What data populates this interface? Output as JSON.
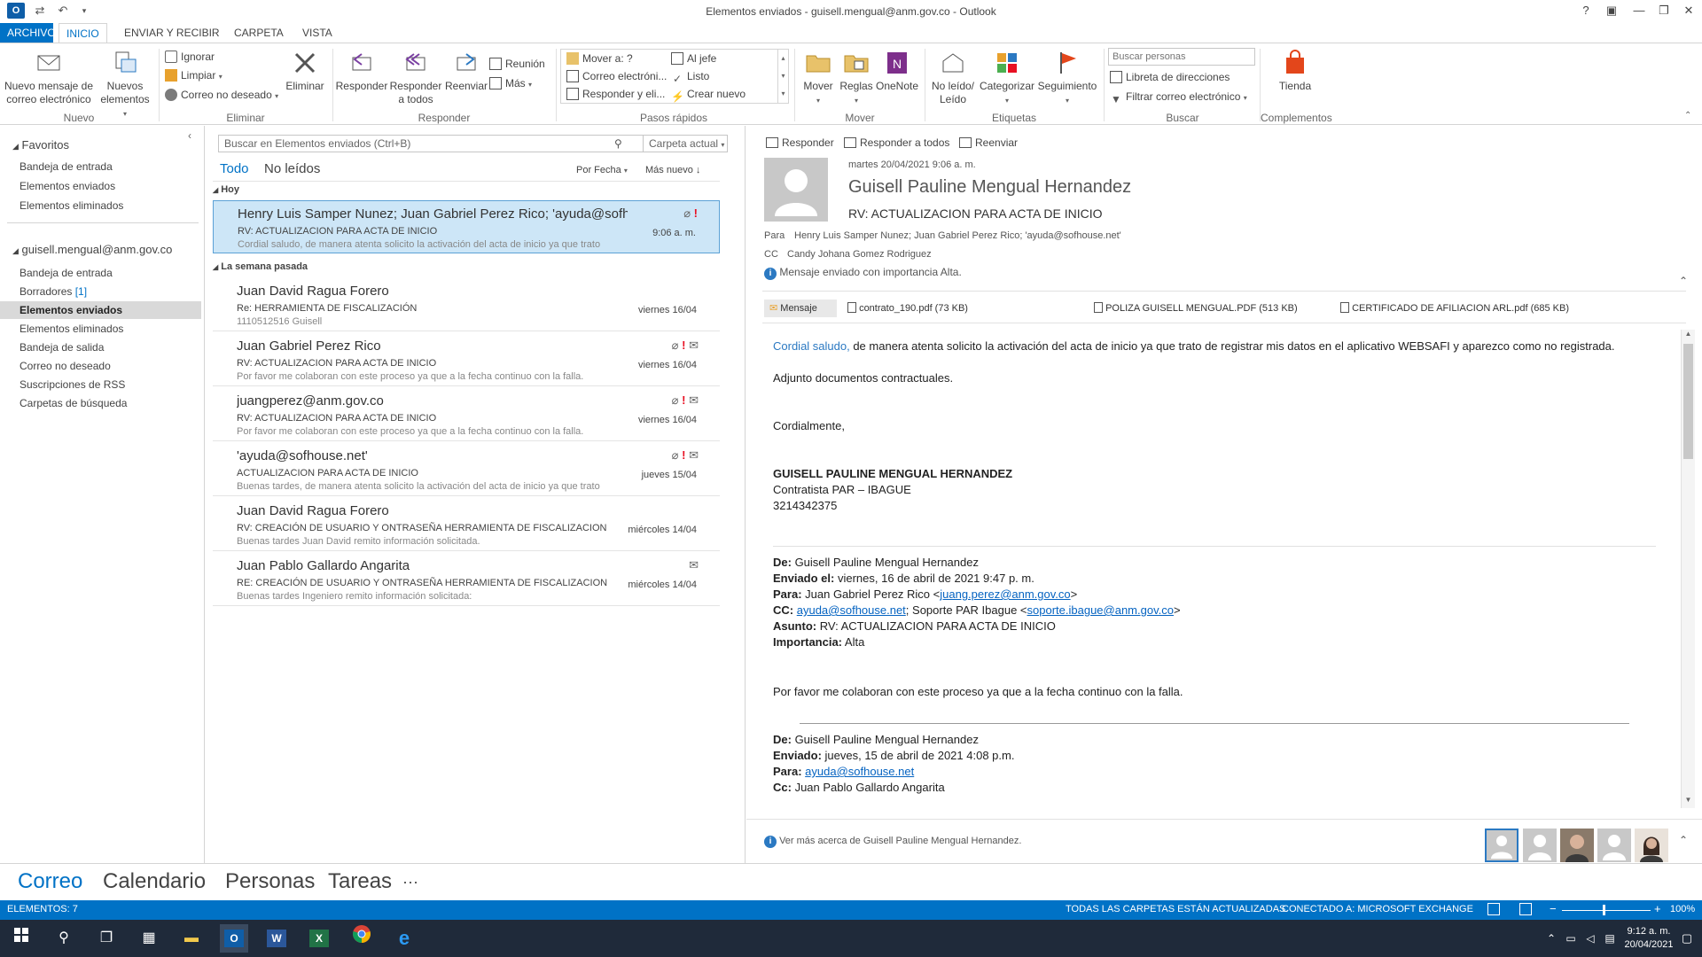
{
  "window": {
    "title": "Elementos enviados - guisell.mengual@anm.gov.co - Outlook"
  },
  "tabs": [
    "ARCHIVO",
    "INICIO",
    "ENVIAR Y RECIBIR",
    "CARPETA",
    "VISTA"
  ],
  "ribbon": {
    "new_email": "Nuevo mensaje de correo electrónico",
    "new_items": "Nuevos elementos",
    "group_new": "Nuevo",
    "ignore": "Ignorar",
    "clean": "Limpiar",
    "junk": "Correo no deseado",
    "delete": "Eliminar",
    "group_delete": "Eliminar",
    "reply": "Responder",
    "reply_all": "Responder a todos",
    "forward": "Reenviar",
    "meeting": "Reunión",
    "more": "Más",
    "group_respond": "Responder",
    "qs_move": "Mover a: ?",
    "qs_email": "Correo electróni...",
    "qs_reply_delete": "Responder y eli...",
    "qs_boss": "Al jefe",
    "qs_done": "Listo",
    "qs_new": "Crear nuevo",
    "group_quicksteps": "Pasos rápidos",
    "move": "Mover",
    "rules": "Reglas",
    "onenote": "OneNote",
    "group_move": "Mover",
    "unread_read": "No leído/ Leído",
    "categorize": "Categorizar",
    "followup": "Seguimiento",
    "group_tags": "Etiquetas",
    "search_people_placeholder": "Buscar personas",
    "address_book": "Libreta de direcciones",
    "filter_email": "Filtrar correo electrónico",
    "group_find": "Buscar",
    "store": "Tienda",
    "group_addins": "Complementos"
  },
  "nav": {
    "favorites": "Favoritos",
    "fav_items": [
      "Bandeja de entrada",
      "Elementos enviados",
      "Elementos eliminados"
    ],
    "account": "guisell.mengual@anm.gov.co",
    "inbox": "Bandeja de entrada",
    "drafts": "Borradores",
    "drafts_count": "[1]",
    "sent": "Elementos enviados",
    "deleted": "Elementos eliminados",
    "outbox": "Bandeja de salida",
    "junk": "Correo no deseado",
    "rss": "Suscripciones de RSS",
    "search_folders": "Carpetas de búsqueda"
  },
  "list": {
    "search_placeholder": "Buscar en Elementos enviados (Ctrl+B)",
    "scope": "Carpeta actual",
    "filter_all": "Todo",
    "filter_unread": "No leídos",
    "sort_by": "Por Fecha",
    "sort_order": "Más nuevo",
    "group_today": "Hoy",
    "group_lastweek": "La semana pasada",
    "messages": [
      {
        "from": "Henry Luis Samper Nunez; Juan Gabriel Perez Rico; 'ayuda@sofh...",
        "subject": "RV: ACTUALIZACION PARA ACTA DE INICIO",
        "preview": "Cordial saludo, de manera atenta solicito la activación del acta de inicio ya que trato",
        "date": "9:06 a. m."
      },
      {
        "from": "Juan David Ragua Forero",
        "subject": "Re: HERRAMIENTA DE FISCALIZACIÓN",
        "preview": "1110512516 Guisell",
        "date": "viernes 16/04"
      },
      {
        "from": "Juan Gabriel Perez Rico",
        "subject": "RV: ACTUALIZACION PARA ACTA DE INICIO",
        "preview": "Por favor me colaboran con este proceso ya que a la fecha continuo con la falla.",
        "date": "viernes 16/04"
      },
      {
        "from": "juangperez@anm.gov.co",
        "subject": "RV: ACTUALIZACION PARA ACTA DE INICIO",
        "preview": "Por favor me colaboran con este proceso ya que a la fecha continuo con la falla.",
        "date": "viernes 16/04"
      },
      {
        "from": "'ayuda@sofhouse.net'",
        "subject": "ACTUALIZACION PARA ACTA DE INICIO",
        "preview": "Buenas tardes, de manera atenta solicito la activación del acta de inicio ya que trato",
        "date": "jueves 15/04"
      },
      {
        "from": "Juan David Ragua Forero",
        "subject": "RV: CREACIÓN DE USUARIO Y ONTRASEÑA HERRAMIENTA DE FISCALIZACION",
        "preview": "Buenas tardes Juan David remito información solicitada.",
        "date": "miércoles 14/04"
      },
      {
        "from": "Juan Pablo Gallardo Angarita",
        "subject": "RE: CREACIÓN DE USUARIO Y ONTRASEÑA HERRAMIENTA DE FISCALIZACION",
        "preview": "Buenas tardes Ingeniero remito información solicitada:",
        "date": "miércoles 14/04"
      }
    ]
  },
  "reading": {
    "reply": "Responder",
    "reply_all": "Responder a todos",
    "forward": "Reenviar",
    "datetime": "martes 20/04/2021 9:06 a. m.",
    "sender": "Guisell Pauline Mengual Hernandez",
    "subject": "RV: ACTUALIZACION PARA ACTA DE INICIO",
    "to_label": "Para",
    "to": "Henry Luis Samper Nunez; Juan Gabriel Perez Rico; 'ayuda@sofhouse.net'",
    "cc_label": "CC",
    "cc": "Candy Johana Gomez Rodriguez",
    "importance": "Mensaje enviado con importancia Alta.",
    "attachments": [
      "Mensaje",
      "contrato_190.pdf (73 KB)",
      "POLIZA GUISELL MENGUAL.PDF (513 KB)",
      "CERTIFICADO DE AFILIACION ARL.pdf (685 KB)"
    ],
    "greeting": "Cordial saludo,",
    "line1": " de manera atenta solicito la activación del acta de inicio ya que trato de registrar mis datos en el aplicativo WEBSAFI y aparezco como no registrada.",
    "line2": "Adjunto documentos contractuales.",
    "closing": "Cordialmente,",
    "sig_name": "GUISELL PAULINE MENGUAL HERNANDEZ",
    "sig_role": "Contratista PAR – IBAGUE",
    "sig_phone": "3214342375",
    "f1_from_label": "De:",
    "f1_from": " Guisell Pauline Mengual Hernandez",
    "f1_sent_label": "Enviado el:",
    "f1_sent": " viernes, 16 de abril de 2021 9:47 p. m.",
    "f1_to_label": "Para:",
    "f1_to_pre": " Juan Gabriel Perez Rico <",
    "f1_to_link": "juang.perez@anm.gov.co",
    "f1_to_post": ">",
    "f1_cc_label": "CC:",
    "f1_cc_link1": "ayuda@sofhouse.net",
    "f1_cc_mid": "; Soporte PAR Ibague <",
    "f1_cc_link2": "soporte.ibague@anm.gov.co",
    "f1_cc_post": ">",
    "f1_subj_label": "Asunto:",
    "f1_subj": " RV: ACTUALIZACION PARA ACTA DE INICIO",
    "f1_imp_label": "Importancia:",
    "f1_imp": " Alta",
    "f1_body": "Por favor me colaboran con este proceso ya que a la fecha continuo con la falla.",
    "f2_from_label": "De:",
    "f2_from": " Guisell Pauline Mengual Hernandez",
    "f2_sent_label": "Enviado:",
    "f2_sent": " jueves, 15 de abril de 2021 4:08 p.m.",
    "f2_to_label": "Para:",
    "f2_to_link": "ayuda@sofhouse.net",
    "f2_cc_label": "Cc:",
    "f2_cc": " Juan Pablo Gallardo Angarita",
    "more_about": "Ver más acerca de Guisell Pauline Mengual Hernandez."
  },
  "bottomnav": [
    "Correo",
    "Calendario",
    "Personas",
    "Tareas",
    "···"
  ],
  "status": {
    "items": "ELEMENTOS: 7",
    "folders": "TODAS LAS CARPETAS ESTÁN ACTUALIZADAS.",
    "connected": "CONECTADO A: MICROSOFT EXCHANGE",
    "zoom": "100%"
  },
  "taskbar": {
    "time": "9:12 a. m.",
    "date": "20/04/2021"
  },
  "colors": {
    "accent": "#0072c6",
    "selected": "#cde6f7",
    "importance": "#e81123"
  }
}
